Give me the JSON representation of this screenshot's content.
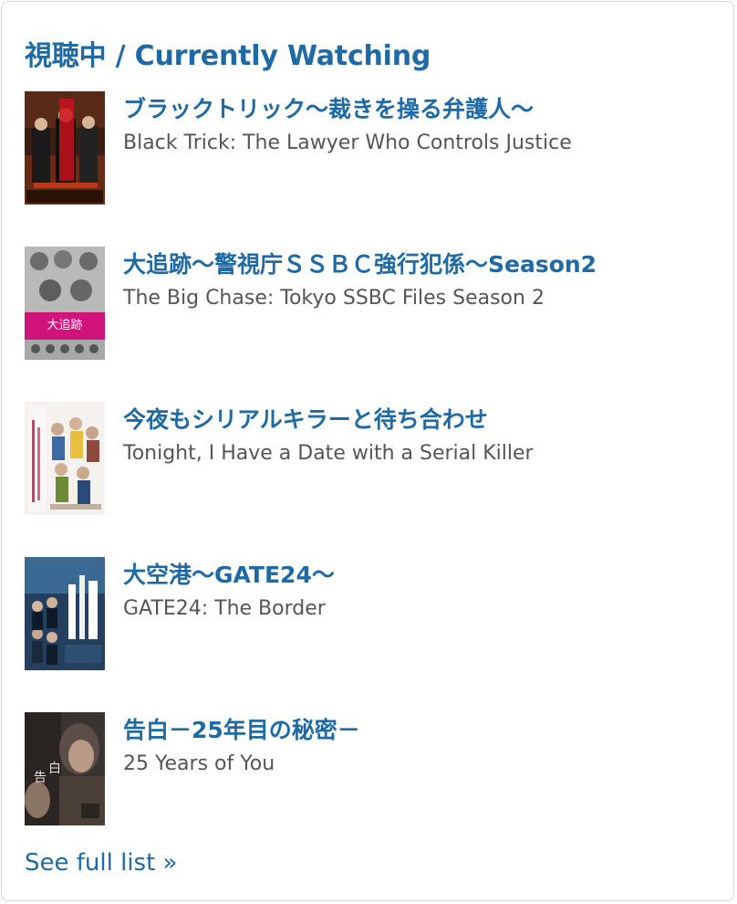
{
  "widget": {
    "title": "視聴中 / Currently Watching",
    "see_full_list": "See full list »"
  },
  "items": [
    {
      "title": "ブラックトリック〜裁きを操る弁護人〜",
      "subtitle": "Black Trick: The Lawyer Who Controls Justice",
      "poster_icon": "poster-black-trick"
    },
    {
      "title": "大追跡〜警視庁ＳＳＢＣ強行犯係〜Season2",
      "subtitle": "The Big Chase: Tokyo SSBC Files Season 2",
      "poster_icon": "poster-big-chase",
      "poster_text": "大追跡"
    },
    {
      "title": "今夜もシリアルキラーと待ち合わせ",
      "subtitle": "Tonight, I Have a Date with a Serial Killer",
      "poster_icon": "poster-serial-killer"
    },
    {
      "title": "大空港〜GATE24〜",
      "subtitle": "GATE24: The Border",
      "poster_icon": "poster-gate24"
    },
    {
      "title": "告白－25年目の秘密－",
      "subtitle": "25 Years of You",
      "poster_icon": "poster-25-years",
      "poster_text_a": "告",
      "poster_text_b": "白"
    }
  ],
  "colors": {
    "link": "#1f6aa5",
    "subtitle": "#555555",
    "border": "#d6d6d6"
  }
}
